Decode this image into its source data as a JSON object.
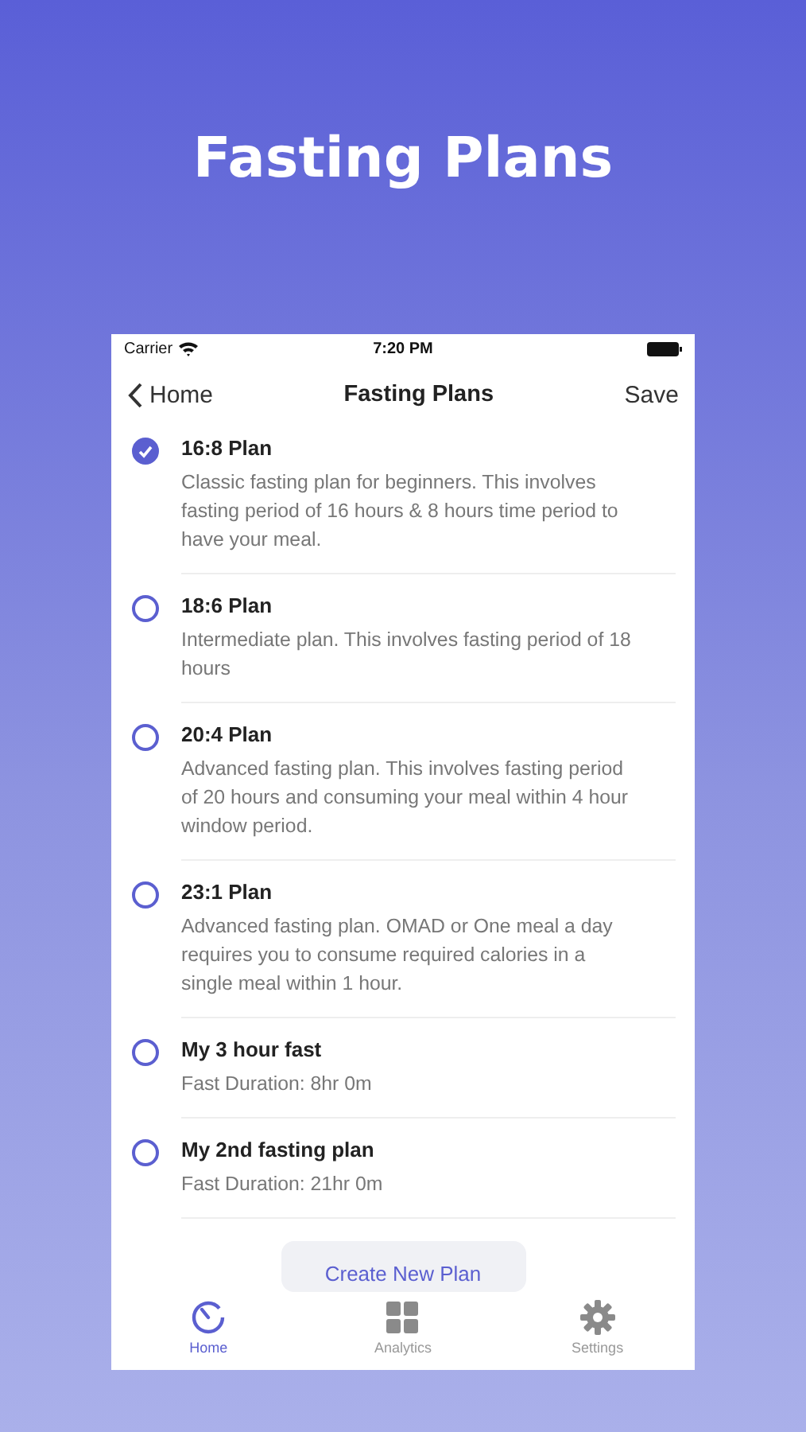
{
  "headline": "Fasting Plans",
  "status_bar": {
    "carrier": "Carrier",
    "time": "7:20 PM"
  },
  "nav": {
    "back": "Home",
    "title": "Fasting Plans",
    "action": "Save"
  },
  "plans": [
    {
      "name": "16:8 Plan",
      "description": "Classic fasting plan for beginners. This involves fasting period of 16 hours & 8 hours time period to have your meal.",
      "selected": true
    },
    {
      "name": "18:6 Plan",
      "description": "Intermediate plan. This involves fasting period of 18 hours",
      "selected": false
    },
    {
      "name": "20:4 Plan",
      "description": "Advanced fasting plan. This involves fasting period of 20 hours and consuming your meal within 4 hour window period.",
      "selected": false
    },
    {
      "name": "23:1 Plan",
      "description": "Advanced fasting plan. OMAD or One meal a day requires you to consume required calories in a single meal within 1 hour.",
      "selected": false
    },
    {
      "name": "My 3 hour fast",
      "description": "Fast Duration: 8hr 0m",
      "selected": false
    },
    {
      "name": "My 2nd fasting plan",
      "description": "Fast Duration: 21hr 0m",
      "selected": false
    }
  ],
  "create_button": "Create New Plan",
  "tabs": [
    {
      "label": "Home",
      "kind": "timer",
      "selected": true
    },
    {
      "label": "Analytics",
      "kind": "grid",
      "selected": false
    },
    {
      "label": "Settings",
      "kind": "gear",
      "selected": false
    }
  ]
}
